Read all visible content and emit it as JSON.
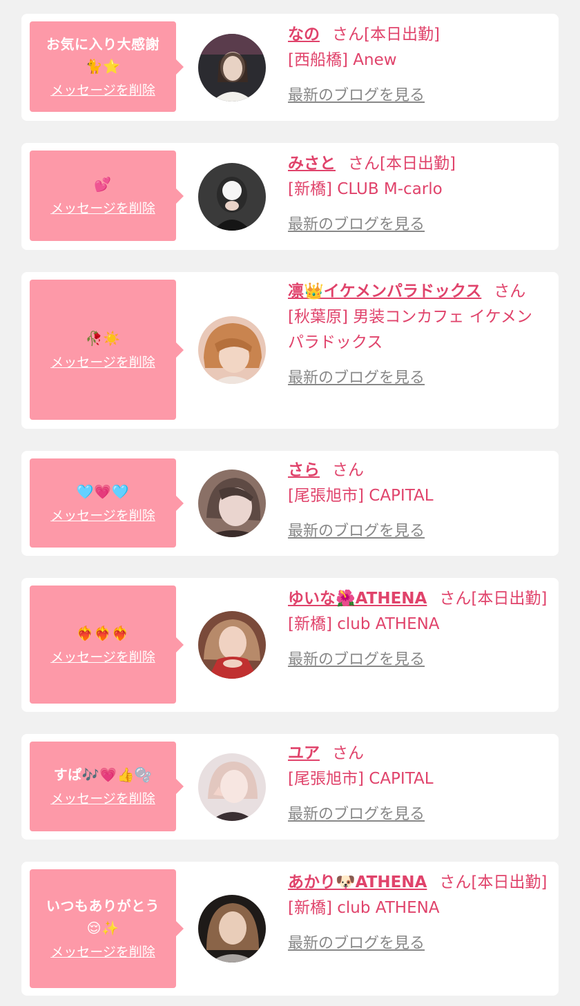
{
  "accent_color": "#e0436b",
  "bubble_color": "#fd99a8",
  "delete_label": "メッセージを削除",
  "blog_label": "最新のブログを見る",
  "favorites": [
    {
      "message": "お気に入り大感謝\n🐈⭐",
      "name": "なの",
      "honorific": "さん[本日出勤]",
      "shop": "[西船橋] Anew",
      "avatar_colors": [
        "#2b2b30",
        "#d9c2b5"
      ]
    },
    {
      "message": "💕",
      "name": "みさと",
      "honorific": "さん[本日出勤]",
      "shop": "[新橋] CLUB M-carlo",
      "avatar_colors": [
        "#3a3a3a",
        "#eeeeee"
      ]
    },
    {
      "message": "🥀☀️",
      "name": "凛👑イケメンパラドックス",
      "honorific": "さん",
      "shop": "[秋葉原] 男装コンカフェ イケメンパラドックス",
      "avatar_colors": [
        "#c9844f",
        "#f2d6c4"
      ]
    },
    {
      "message": "🩵💗🩵",
      "name": "さら",
      "honorific": "さん",
      "shop": "[尾張旭市] CAPITAL",
      "avatar_colors": [
        "#8a7066",
        "#ead5cf"
      ]
    },
    {
      "message": "❤️‍🔥❤️‍🔥❤️‍🔥",
      "name": "ゆいな🌺ATHENA",
      "honorific": "さん[本日出勤]",
      "shop": "[新橋] club ATHENA",
      "avatar_colors": [
        "#7a4a3a",
        "#c03030"
      ]
    },
    {
      "message": "すぱ🎶💗👍🫧",
      "name": "ユア",
      "honorific": "さん",
      "shop": "[尾張旭市] CAPITAL",
      "avatar_colors": [
        "#e8dfe0",
        "#3a2f32"
      ]
    },
    {
      "message": "いつもありがとう\n😌✨",
      "name": "あかり🐶ATHENA",
      "honorific": "さん[本日出勤]",
      "shop": "[新橋] club ATHENA",
      "avatar_colors": [
        "#1e1a18",
        "#c9a88c"
      ]
    }
  ]
}
